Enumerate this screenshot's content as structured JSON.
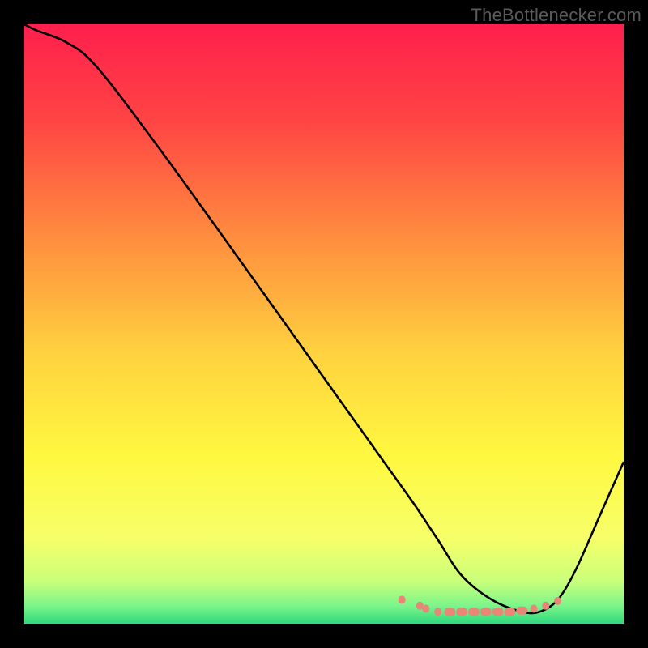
{
  "credit": "TheBottlenecker.com",
  "chart_data": {
    "type": "line",
    "title": "",
    "xlabel": "",
    "ylabel": "",
    "xlim": [
      0,
      100
    ],
    "ylim": [
      0,
      100
    ],
    "background_gradient_stops": [
      {
        "pos": 0,
        "color": "#ff1f4d"
      },
      {
        "pos": 16,
        "color": "#ff4444"
      },
      {
        "pos": 35,
        "color": "#ff8b3f"
      },
      {
        "pos": 55,
        "color": "#ffd23f"
      },
      {
        "pos": 72,
        "color": "#fff840"
      },
      {
        "pos": 86,
        "color": "#f6ff6a"
      },
      {
        "pos": 93,
        "color": "#c8ff7a"
      },
      {
        "pos": 97,
        "color": "#7cf58a"
      },
      {
        "pos": 100,
        "color": "#2fd87e"
      }
    ],
    "curve_main": {
      "x": [
        0,
        2,
        7,
        12,
        22,
        35,
        50,
        60,
        65,
        69,
        73,
        78,
        83,
        86,
        89,
        92,
        96,
        100
      ],
      "y": [
        100,
        99,
        97,
        93,
        80,
        62,
        41,
        27,
        20,
        14,
        8,
        4,
        2,
        2,
        4,
        9,
        18,
        27
      ]
    },
    "flat_markers": {
      "x": [
        63,
        66,
        67,
        69,
        71,
        73,
        75,
        77,
        79,
        81,
        83,
        85,
        87,
        89
      ],
      "y": [
        4,
        3,
        2.5,
        2,
        2,
        2,
        2,
        2,
        2,
        2,
        2.2,
        2.5,
        3,
        3.8
      ],
      "color": "#e88677",
      "radius": 5
    }
  }
}
